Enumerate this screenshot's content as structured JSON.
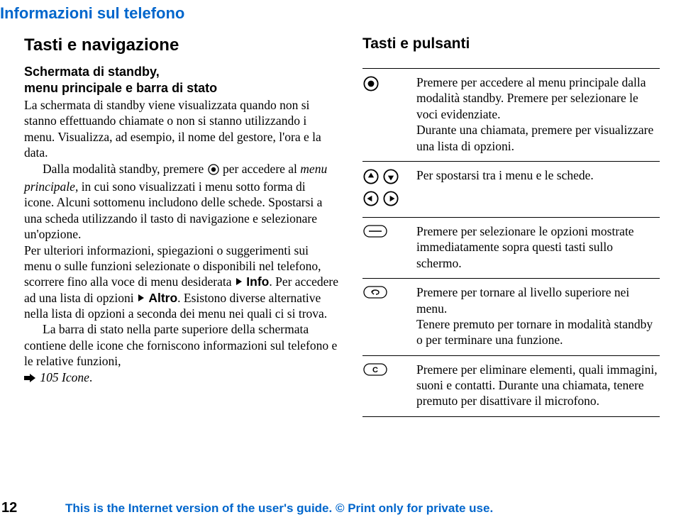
{
  "header": {
    "title": "Informazioni sul telefono"
  },
  "left": {
    "section_title": "Tasti e navigazione",
    "sub_title_line1": "Schermata di standby,",
    "sub_title_line2": "menu principale e barra di stato",
    "p1a": "La schermata di standby viene visualizzata quando non si stanno effettuando chiamate o non si stanno utilizzando i menu. Visualizza, ad esempio, il nome del gestore, l'ora e la data.",
    "p1b_before": "Dalla modalità standby, premere ",
    "p1b_after": " per accedere al ",
    "p1b_menu": "menu principale",
    "p1b_tail": ", in cui sono visualizzati i menu sotto forma di icone. Alcuni sottomenu includono delle schede. Spostarsi a una scheda utilizzando il tasto di navigazione e selezionare un'opzione.",
    "p1c_before": "Per ulteriori informazioni, spiegazioni o suggerimenti sui menu o sulle funzioni selezionate o disponibili nel telefono, scorrere fino alla voce di menu desiderata ",
    "info_label": "Info",
    "p1c_mid": ". Per accedere ad una lista di opzioni ",
    "altro_label": "Altro",
    "p1c_tail": ". Esistono diverse alternative nella lista di opzioni a seconda dei menu nei quali ci si trova.",
    "p2_before": "La barra di stato nella parte superiore della schermata contiene delle icone che forniscono informazioni sul telefono e le relative funzioni, ",
    "p2_ref": "105 Icone",
    "p2_tail": "."
  },
  "right": {
    "heading": "Tasti e pulsanti",
    "rows": [
      {
        "desc": "Premere per accedere al menu principale dalla modalità standby. Premere per selezionare le voci evidenziate.\nDurante una chiamata, premere per visualizzare una lista di opzioni."
      },
      {
        "desc": "Per spostarsi tra i menu e le schede."
      },
      {
        "desc": "Premere per selezionare le opzioni mostrate immediatamente sopra questi tasti sullo schermo."
      },
      {
        "desc": "Premere per tornare al livello superiore nei menu.\nTenere premuto per tornare in modalità standby o per terminare una funzione."
      },
      {
        "desc": "Premere per eliminare elementi, quali immagini, suoni e contatti. Durante una chiamata, tenere premuto per disattivare il microfono."
      }
    ]
  },
  "footer": {
    "page": "12",
    "text": "This is the Internet version of the user's guide. © Print only for private use."
  }
}
